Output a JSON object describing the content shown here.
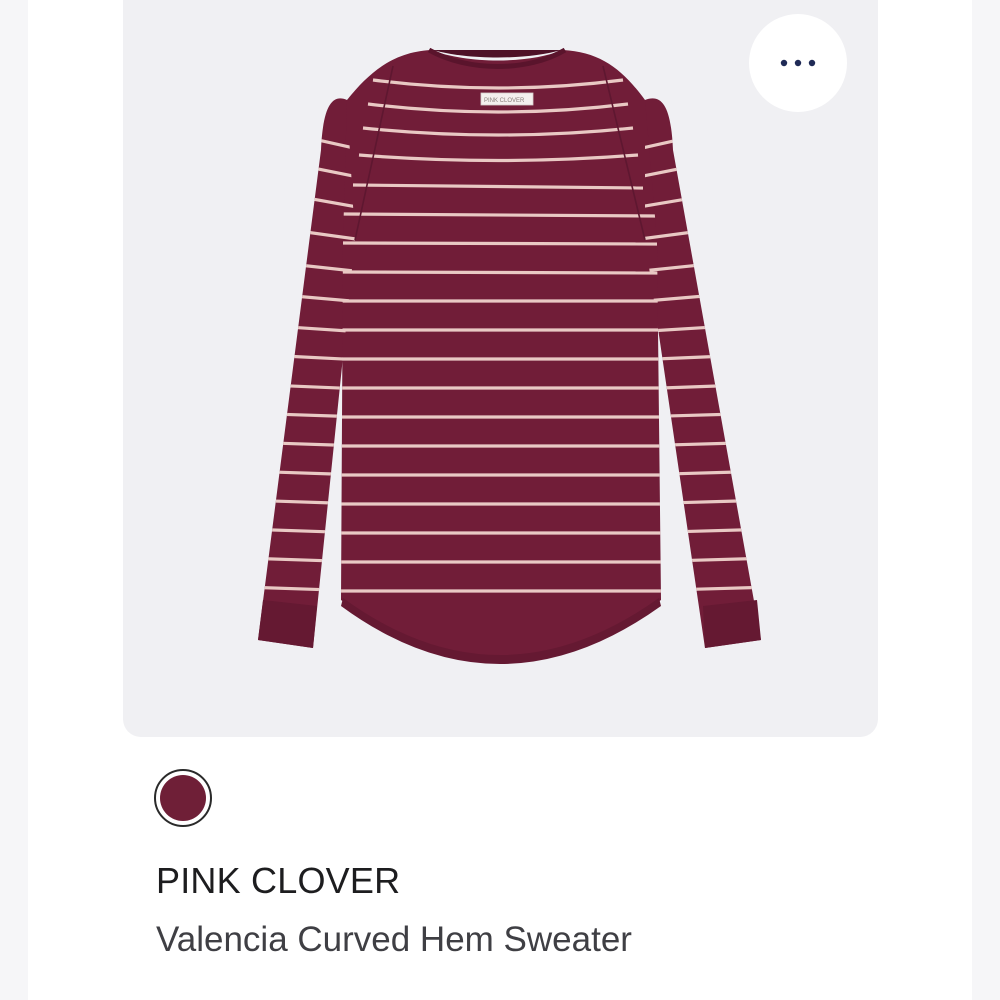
{
  "product": {
    "brand": "PINK CLOVER",
    "name": "Valencia Curved Hem Sweater",
    "tag_text": "PINK CLOVER"
  },
  "swatches": [
    {
      "color": "#6f1f37",
      "selected": true
    }
  ],
  "colors": {
    "card_background": "#f0f0f3",
    "sweater": "#711d38",
    "sweater_shade": "#5e1730",
    "stripe": "#e9c9c4",
    "menu_dots": "#1f2a56"
  },
  "icons": {
    "more": "more-horizontal-icon"
  }
}
